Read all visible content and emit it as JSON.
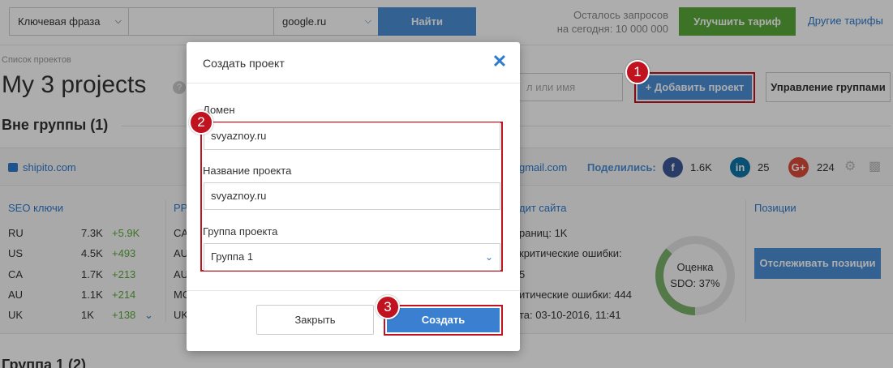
{
  "topbar": {
    "keyword_select": "Ключевая фраза",
    "engine_select": "google.ru",
    "find_button": "Найти",
    "quota_line1": "Осталось запросов",
    "quota_line2": "на сегодня: 10 000 000",
    "upgrade_button": "Улучшить тариф",
    "other_tariffs_link": "Другие тарифы"
  },
  "header": {
    "breadcrumb": "Список проектов",
    "title": "My 3 projects",
    "search_placeholder": "л или имя",
    "add_project_button": "+ Добавить проект",
    "manage_groups_button": "Управление группами"
  },
  "section": {
    "title": "Вне группы (1)"
  },
  "project_card": {
    "domain": "shipito.com",
    "email": "gmail.com",
    "shared_label": "Поделились:",
    "social": [
      {
        "icon": "facebook-icon",
        "glyph": "f",
        "count": "1.6K",
        "color": "#3b5998"
      },
      {
        "icon": "linkedin-icon",
        "glyph": "in",
        "count": "25",
        "color": "#0e76a8"
      },
      {
        "icon": "google-plus-icon",
        "glyph": "G+",
        "count": "224",
        "color": "#dd4b39"
      }
    ],
    "seo_title": "SEO ключи",
    "seo_rows": [
      {
        "country": "RU",
        "value": "7.3K",
        "delta": "+5.9K"
      },
      {
        "country": "US",
        "value": "4.5K",
        "delta": "+493"
      },
      {
        "country": "CA",
        "value": "1.7K",
        "delta": "+213"
      },
      {
        "country": "AU",
        "value": "1.1K",
        "delta": "+214"
      },
      {
        "country": "UK",
        "value": "1K",
        "delta": "+138"
      }
    ],
    "pp_title": "PP",
    "pp_rows": [
      "CA",
      "AU",
      "AU",
      "MC",
      "UK"
    ],
    "audit_title": "дит сайта",
    "audit_rows": [
      "раниц: 1K",
      "критические ошибки:",
      "5",
      "итические ошибки: 444",
      "та: 03-10-2016, 11:41"
    ],
    "score_label": "Оценка",
    "score_value": "SDO: 37%",
    "score_fraction": 0.37,
    "positions_title": "Позиции",
    "track_button": "Отслеживать позиции"
  },
  "group2": {
    "title": "Группа 1 (2)"
  },
  "modal": {
    "title": "Создать проект",
    "domain_label": "Домен",
    "domain_value": "svyaznoy.ru",
    "name_label": "Название проекта",
    "name_value": "svyaznoy.ru",
    "group_label": "Группа проекта",
    "group_value": "Группа 1",
    "close_button": "Закрыть",
    "create_button": "Создать"
  },
  "markers": [
    "1",
    "2",
    "3"
  ],
  "colors": {
    "accent": "#4a8fd8",
    "highlight": "#c1121f",
    "success": "#5aaa3a"
  }
}
